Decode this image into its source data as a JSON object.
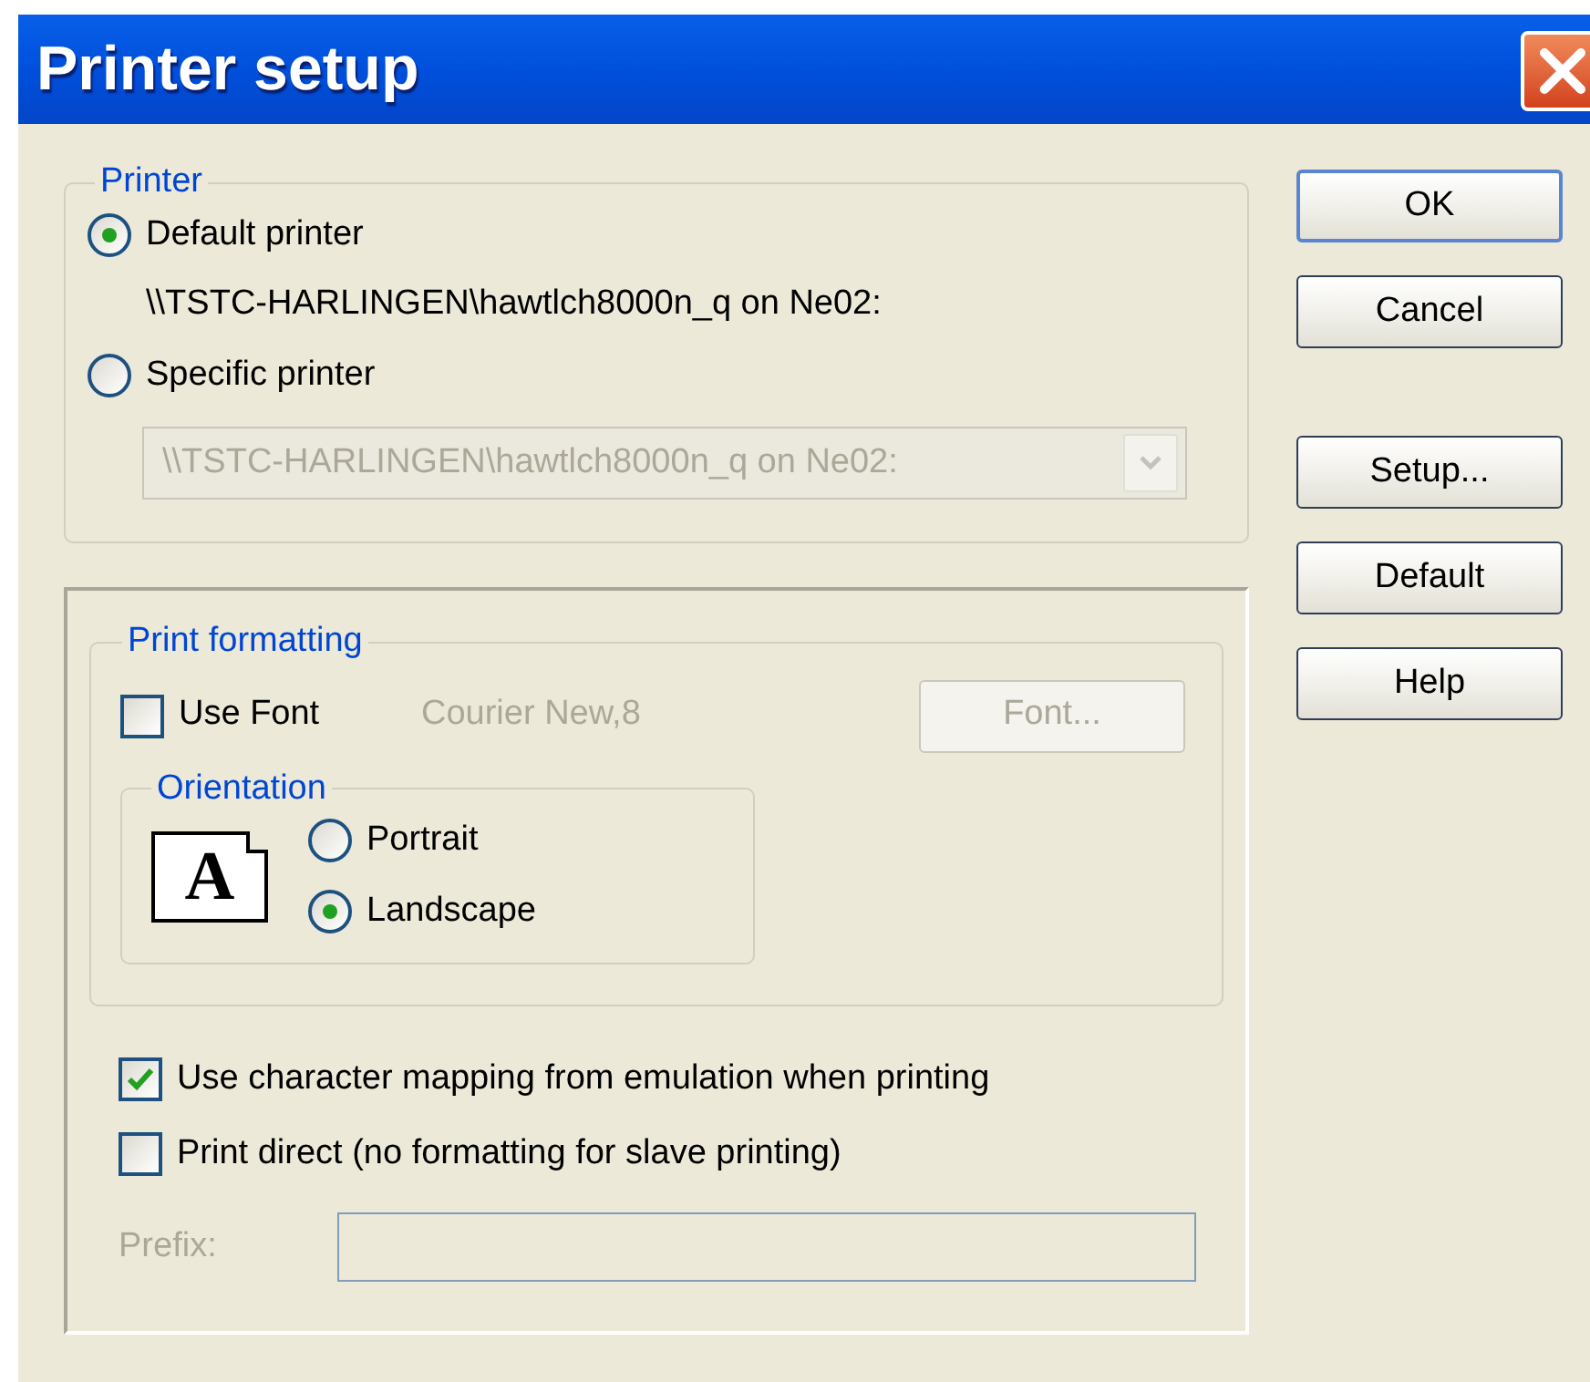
{
  "window": {
    "title": "Printer setup"
  },
  "printer": {
    "legend": "Printer",
    "options": [
      {
        "label": "Default printer",
        "selected": true
      },
      {
        "label": "Specific printer",
        "selected": false
      }
    ],
    "default_name": "\\\\TSTC-HARLINGEN\\hawtlch8000n_q on Ne02:",
    "combo": {
      "value": "\\\\TSTC-HARLINGEN\\hawtlch8000n_q on Ne02:",
      "disabled": true
    }
  },
  "print_formatting": {
    "legend": "Print formatting",
    "use_font": {
      "label": "Use Font",
      "checked": false
    },
    "font_name": "Courier New,8",
    "font_button": {
      "label": "Font...",
      "disabled": true
    },
    "orientation": {
      "legend": "Orientation",
      "preview": "A",
      "options": [
        {
          "label": "Portrait",
          "selected": false
        },
        {
          "label": "Landscape",
          "selected": true
        }
      ]
    }
  },
  "options": [
    {
      "label": "Use character mapping from emulation when printing",
      "checked": true
    },
    {
      "label": "Print direct (no formatting for slave printing)",
      "checked": false
    }
  ],
  "prefix": {
    "label": "Prefix:",
    "disabled": true
  },
  "button_groups": [
    [
      {
        "label": "OK",
        "default": true
      },
      {
        "label": "Cancel",
        "default": false
      }
    ],
    [
      {
        "label": "Setup...",
        "default": false
      },
      {
        "label": "Default",
        "default": false
      },
      {
        "label": "Help",
        "default": false
      }
    ]
  ]
}
